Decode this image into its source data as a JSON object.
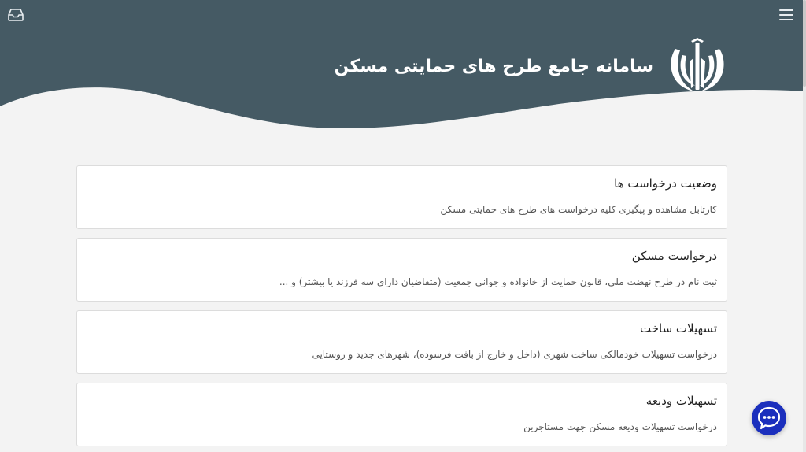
{
  "header": {
    "site_title": "سامانه جامع طرح های حمایتی مسکن",
    "colors": {
      "header_bg": "#455a64",
      "page_bg": "#f3f3f3",
      "chat_bg": "#1b2fbd"
    },
    "icons": {
      "menu": "hamburger-icon",
      "inbox": "inbox-icon",
      "emblem": "iran-emblem-icon"
    }
  },
  "services": [
    {
      "title": "وضعیت درخواست ها",
      "description": "کارتابل مشاهده و پیگیری کلیه درخواست های طرح های حمایتی مسکن"
    },
    {
      "title": "درخواست مسکن",
      "description": "ثبت نام در طرح نهضت ملی، قانون حمایت از خانواده و جوانی جمعیت (متقاضیان دارای سه فرزند یا بیشتر) و ..."
    },
    {
      "title": "تسهیلات ساخت",
      "description": "درخواست تسهیلات خودمالکی ساخت شهری (داخل و خارج از بافت فرسوده)، شهرهای جدید و روستایی"
    },
    {
      "title": "تسهیلات ودیعه",
      "description": "درخواست تسهیلات ودیعه مسکن جهت مستاجرین"
    }
  ],
  "chat": {
    "icon": "chat-bubble-icon"
  }
}
